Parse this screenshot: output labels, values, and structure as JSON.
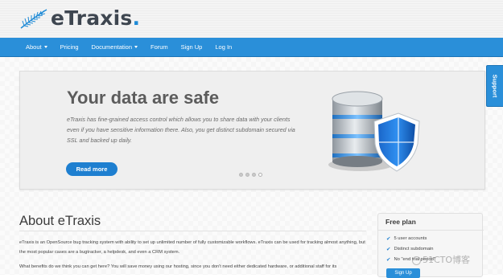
{
  "brand": {
    "name": "eTraxis",
    "dot": "."
  },
  "nav": {
    "items": [
      {
        "label": "About",
        "has_dropdown": true
      },
      {
        "label": "Pricing",
        "has_dropdown": false
      },
      {
        "label": "Documentation",
        "has_dropdown": true
      },
      {
        "label": "Forum",
        "has_dropdown": false
      },
      {
        "label": "Sign Up",
        "has_dropdown": false
      },
      {
        "label": "Log In",
        "has_dropdown": false
      }
    ]
  },
  "support_tab": {
    "label": "Support"
  },
  "hero": {
    "title": "Your data are safe",
    "body": "eTraxis has fine-grained access control which allows you to share data with your clients even if you have sensitive information there. Also, you get distinct subdomain secured via SSL and backed up daily.",
    "button": "Read more",
    "slides": 4,
    "active_slide": 4
  },
  "about": {
    "title": "About eTraxis",
    "p1": "eTraxis is an OpenSource bug tracking system with ability to set up unlimited number of fully customizable workflows. eTraxis can be used for tracking almost anything, but the most popular cases are a bugtracker, a helpdesk, and even a CRM system.",
    "p2": "What benefits do we think you can get here? You will save money using our hosting, since you don't need either dedicated hardware, or additional staff for its"
  },
  "free_plan": {
    "title": "Free plan",
    "features": [
      "5 user accounts",
      "Distinct subdomain",
      "No \"end trial period\""
    ],
    "button": "Sign Up"
  },
  "watermark": {
    "text": "51CTO博客"
  },
  "colors": {
    "accent": "#2a8fd9",
    "button": "#1e7fd0",
    "text": "#3e4650"
  }
}
